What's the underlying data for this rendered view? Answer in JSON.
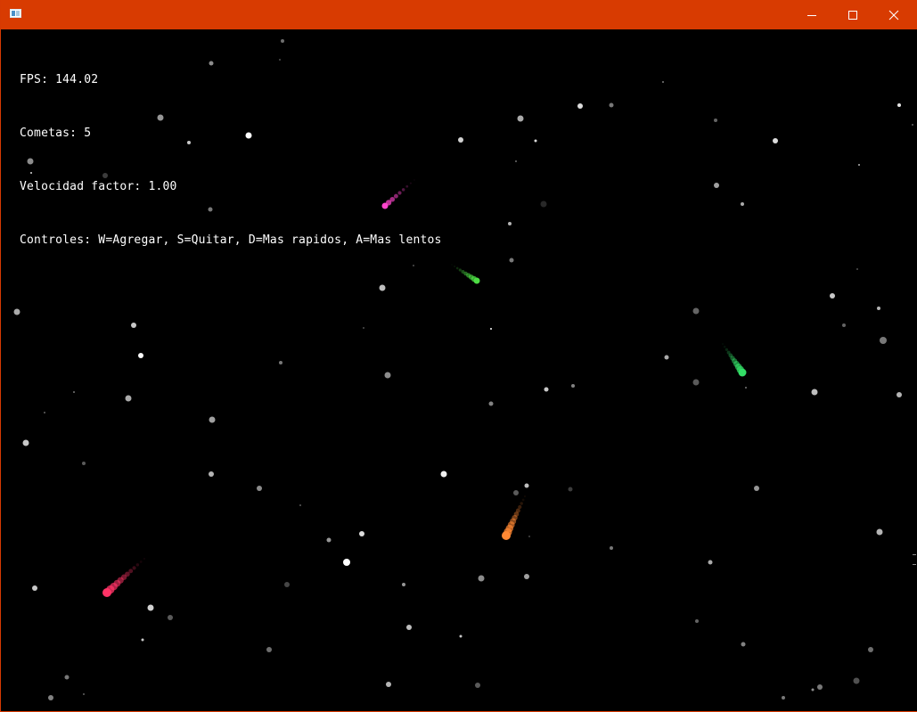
{
  "window": {
    "title": "",
    "titlebar_color": "#d83b01",
    "icons": {
      "app": "app-window-icon",
      "minimize": "minimize-icon",
      "maximize": "maximize-icon",
      "close": "close-icon"
    }
  },
  "hud": {
    "fps": "FPS: 144.02",
    "comets": "Cometas: 5",
    "speed": "Velocidad factor: 1.00",
    "controls": "Controles: W=Agregar, S=Quitar, D=Mas rapidos, A=Mas lentos"
  },
  "scene": {
    "background": "#000000",
    "comet_colors": [
      "#ff44cc",
      "#4ddd44",
      "#33dd66",
      "#ff8833",
      "#ff3366"
    ]
  }
}
